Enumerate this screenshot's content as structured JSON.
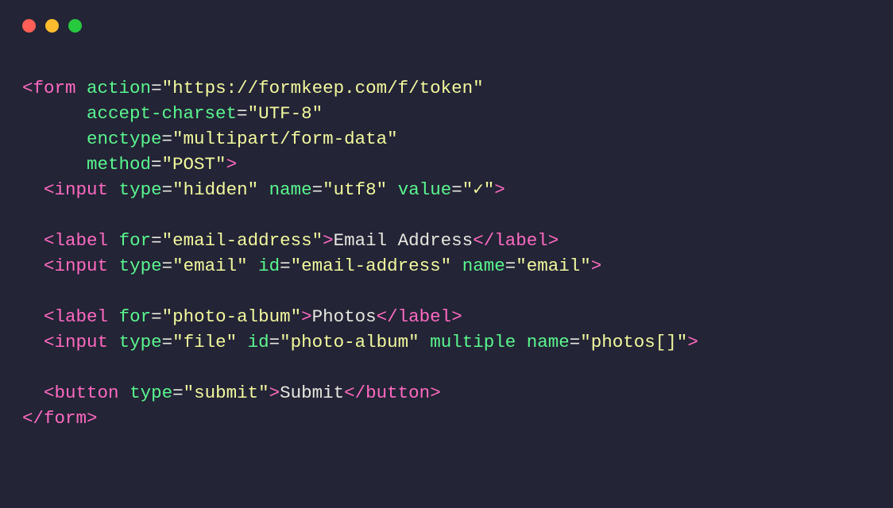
{
  "colors": {
    "bg": "#232436",
    "red": "#ff5f56",
    "yellow": "#ffbd2e",
    "green": "#27c93f",
    "tag": "#ff6ac1",
    "attr": "#5af78e",
    "string": "#f3f99d",
    "text": "#e7e7df"
  },
  "code": {
    "l1": {
      "open": "<",
      "tag": "form",
      "sp": " ",
      "a1": "action",
      "eq": "=",
      "v1": "\"https://formkeep.com/f/token\""
    },
    "l2": {
      "pad": "      ",
      "a1": "accept-charset",
      "eq": "=",
      "v1": "\"UTF-8\""
    },
    "l3": {
      "pad": "      ",
      "a1": "enctype",
      "eq": "=",
      "v1": "\"multipart/form-data\""
    },
    "l4": {
      "pad": "      ",
      "a1": "method",
      "eq": "=",
      "v1": "\"POST\"",
      "close": ">"
    },
    "l5": {
      "pad": "  ",
      "open": "<",
      "tag": "input",
      "sp": " ",
      "a1": "type",
      "eq": "=",
      "v1": "\"hidden\"",
      "sp2": " ",
      "a2": "name",
      "v2": "\"utf8\"",
      "sp3": " ",
      "a3": "value",
      "v3": "\"✓\"",
      "close": ">"
    },
    "l7": {
      "pad": "  ",
      "open": "<",
      "tag": "label",
      "sp": " ",
      "a1": "for",
      "eq": "=",
      "v1": "\"email-address\"",
      "gt": ">",
      "text": "Email Address",
      "open2": "</",
      "tag2": "label",
      "close": ">"
    },
    "l8": {
      "pad": "  ",
      "open": "<",
      "tag": "input",
      "sp": " ",
      "a1": "type",
      "eq": "=",
      "v1": "\"email\"",
      "sp2": " ",
      "a2": "id",
      "v2": "\"email-address\"",
      "sp3": " ",
      "a3": "name",
      "v3": "\"email\"",
      "close": ">"
    },
    "l10": {
      "pad": "  ",
      "open": "<",
      "tag": "label",
      "sp": " ",
      "a1": "for",
      "eq": "=",
      "v1": "\"photo-album\"",
      "gt": ">",
      "text": "Photos",
      "open2": "</",
      "tag2": "label",
      "close": ">"
    },
    "l11": {
      "pad": "  ",
      "open": "<",
      "tag": "input",
      "sp": " ",
      "a1": "type",
      "eq": "=",
      "v1": "\"file\"",
      "sp2": " ",
      "a2": "id",
      "v2": "\"photo-album\"",
      "sp3": " ",
      "a3": "multiple",
      "sp4": " ",
      "a4": "name",
      "v4": "\"photos[]\"",
      "close": ">"
    },
    "l13": {
      "pad": "  ",
      "open": "<",
      "tag": "button",
      "sp": " ",
      "a1": "type",
      "eq": "=",
      "v1": "\"submit\"",
      "gt": ">",
      "text": "Submit",
      "open2": "</",
      "tag2": "button",
      "close": ">"
    },
    "l14": {
      "open": "</",
      "tag": "form",
      "close": ">"
    }
  }
}
